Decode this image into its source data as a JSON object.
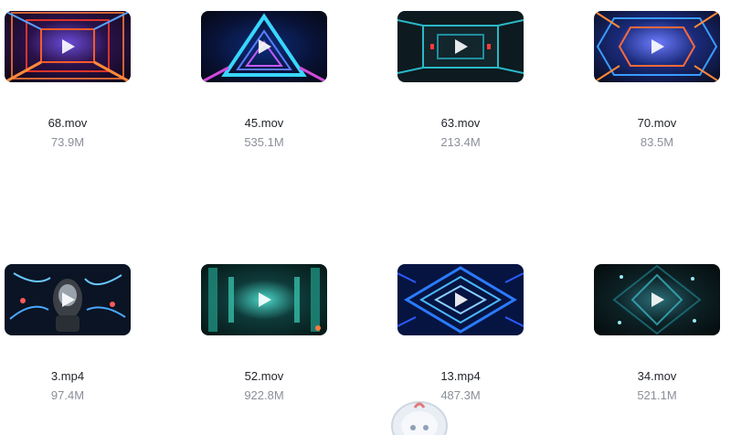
{
  "files": [
    {
      "name": "68.mov",
      "size": "73.9M",
      "theme": "red-corridor"
    },
    {
      "name": "45.mov",
      "size": "535.1M",
      "theme": "blue-triangle"
    },
    {
      "name": "63.mov",
      "size": "213.4M",
      "theme": "teal-corridor"
    },
    {
      "name": "70.mov",
      "size": "83.5M",
      "theme": "orange-tunnel"
    },
    {
      "name": "3.mp4",
      "size": "97.4M",
      "theme": "robot-head"
    },
    {
      "name": "52.mov",
      "size": "922.8M",
      "theme": "green-tunnel"
    },
    {
      "name": "13.mp4",
      "size": "487.3M",
      "theme": "blue-diamond"
    },
    {
      "name": "34.mov",
      "size": "521.1M",
      "theme": "dark-teal-tunnel"
    }
  ],
  "colors": {
    "filename": "#1f2329",
    "filesize": "#8a8f99",
    "play_icon": "#ffffff"
  }
}
